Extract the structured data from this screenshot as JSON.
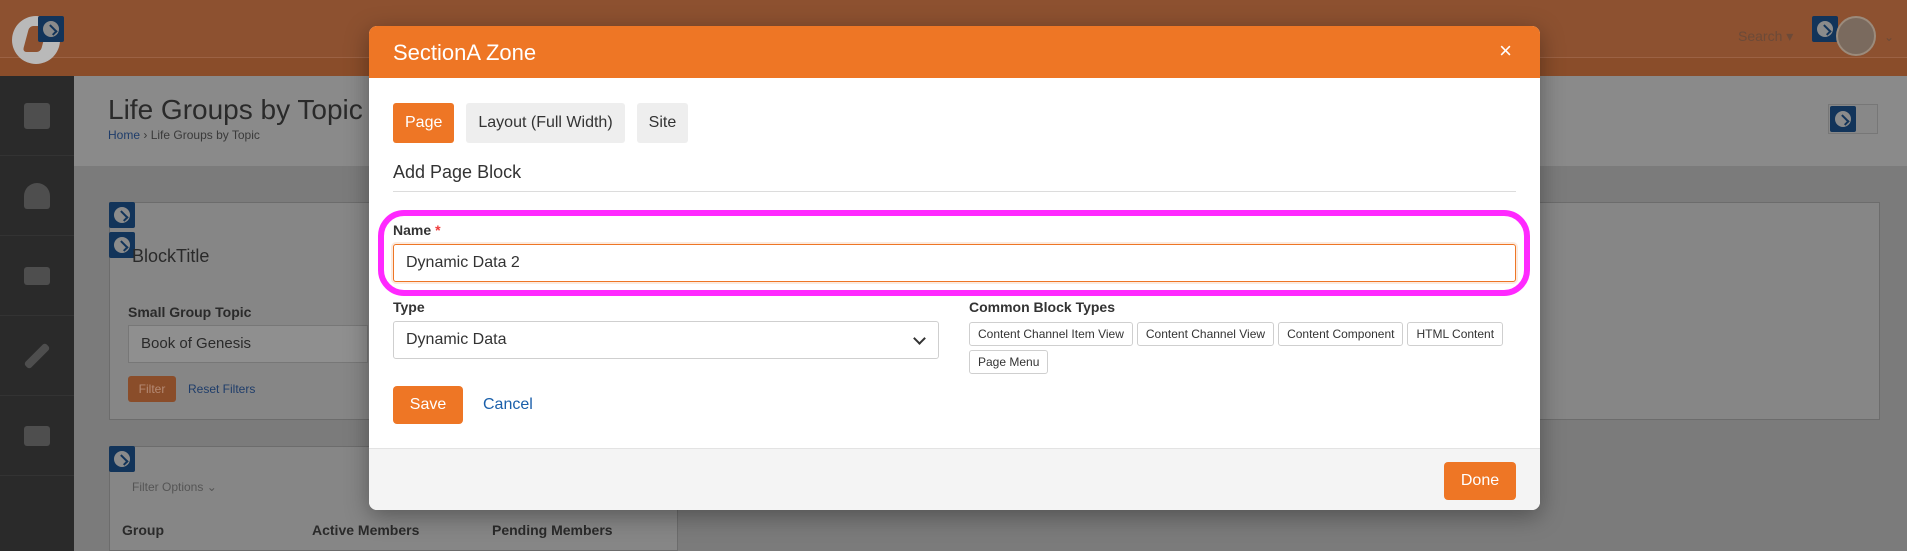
{
  "background": {
    "page_title": "Life Groups by Topic",
    "breadcrumb": {
      "home": "Home",
      "sep": "›",
      "current": "Life Groups by Topic"
    },
    "search_label": "Search ▾",
    "block_title": "BlockTitle",
    "filter": {
      "label": "Small Group Topic",
      "value": "Book of Genesis",
      "filter_button": "Filter",
      "reset_link": "Reset Filters"
    },
    "filter_options": "Filter Options ⌄",
    "table_headers": [
      "Group",
      "Active Members",
      "Pending Members"
    ]
  },
  "modal": {
    "title": "SectionA Zone",
    "close_glyph": "×",
    "tabs": [
      {
        "label": "Page",
        "active": true
      },
      {
        "label": "Layout (Full Width)",
        "active": false
      },
      {
        "label": "Site",
        "active": false
      }
    ],
    "section_title": "Add Page Block",
    "name": {
      "label": "Name",
      "required_mark": "*",
      "value": "Dynamic Data 2"
    },
    "type": {
      "label": "Type",
      "value": "Dynamic Data"
    },
    "common_block_types": {
      "label": "Common Block Types",
      "items": [
        "Content Channel Item View",
        "Content Channel View",
        "Content Component",
        "HTML Content",
        "Page Menu"
      ]
    },
    "save_label": "Save",
    "cancel_label": "Cancel",
    "done_label": "Done"
  },
  "colors": {
    "accent": "#ee7625",
    "highlight": "#ff29ff",
    "link": "#1a5faa"
  }
}
